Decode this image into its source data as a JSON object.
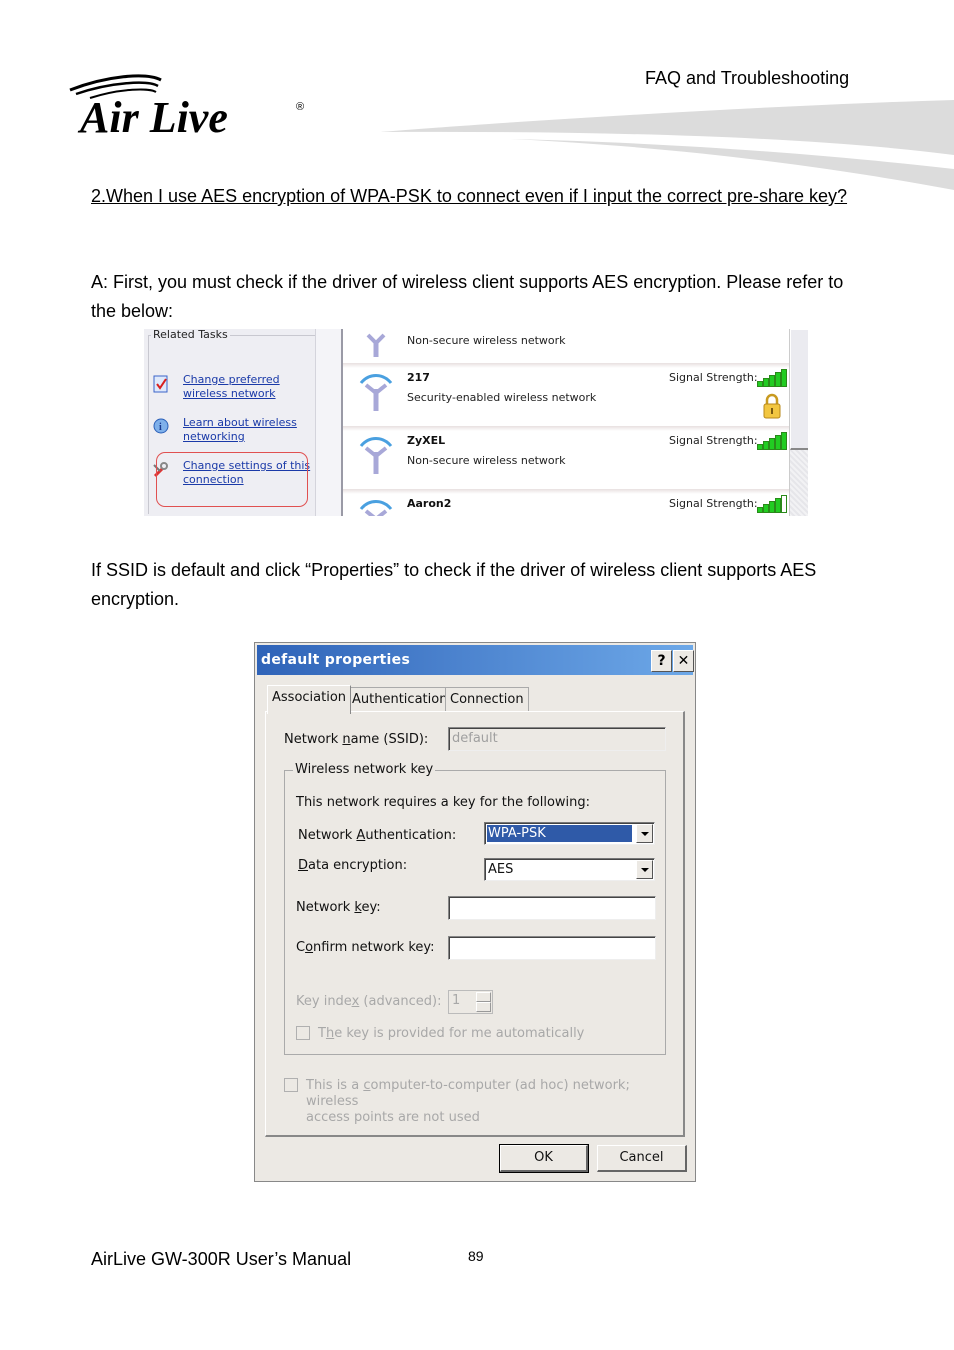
{
  "header": {
    "logo_text": "Air Live",
    "logo_mark": "®",
    "section_title": "FAQ and Troubleshooting"
  },
  "question": "2.When I use AES encryption of WPA-PSK to connect even if I input the correct pre-share key?",
  "answer": "A: First, you must check if the driver of wireless client supports AES encryption. Please refer to the below:",
  "instruction": "If SSID is default and click “Properties” to check if the driver of wireless client supports AES encryption.",
  "screenshot1": {
    "related_tasks": {
      "title": "Related Tasks",
      "items": [
        {
          "label": "Change preferred wireless network",
          "icon": "checklist-icon"
        },
        {
          "label": "Learn about wireless networking",
          "icon": "info-icon"
        },
        {
          "label": "Change settings of this connection",
          "icon": "settings-tools-icon",
          "highlighted": true
        }
      ]
    },
    "signal_label": "Signal Strength:",
    "networks": [
      {
        "name": "",
        "description": "Non-secure wireless network",
        "signal_bars": null,
        "secured": false
      },
      {
        "name": "217",
        "description": "Security-enabled wireless network",
        "signal_bars": 5,
        "secured": true
      },
      {
        "name": "ZyXEL",
        "description": "Non-secure wireless network",
        "signal_bars": 5,
        "secured": false
      },
      {
        "name": "Aaron2",
        "description": "",
        "signal_bars": 4,
        "secured": false
      }
    ],
    "signal_max": 5
  },
  "dialog": {
    "title": "default properties",
    "help_button": "?",
    "close_button": "✕",
    "tabs": [
      {
        "label": "Association",
        "active": true
      },
      {
        "label": "Authentication",
        "active": false
      },
      {
        "label": "Connection",
        "active": false
      }
    ],
    "ssid_label_pre": "Network ",
    "ssid_label_acc": "n",
    "ssid_label_post": "ame (SSID):",
    "ssid_value": "default",
    "group_title": "Wireless network key",
    "requires_text": "This network requires a key for the following:",
    "auth_label_pre": "Network ",
    "auth_label_acc": "A",
    "auth_label_post": "uthentication:",
    "auth_value": "WPA-PSK",
    "enc_label_acc": "D",
    "enc_label_post": "ata encryption:",
    "enc_value": "AES",
    "key_label_pre": "Network ",
    "key_label_acc": "k",
    "key_label_post": "ey:",
    "key_value": "",
    "confirm_label_pre": "C",
    "confirm_label_acc": "o",
    "confirm_label_post": "nfirm network key:",
    "confirm_value": "",
    "index_label_pre": "Key inde",
    "index_label_acc": "x",
    "index_label_post": " (advanced):",
    "index_value": "1",
    "auto_key_pre": "T",
    "auto_key_acc": "h",
    "auto_key_post": "e key is provided for me automatically",
    "adhoc_pre": "This is a ",
    "adhoc_acc": "c",
    "adhoc_post": "omputer-to-computer (ad hoc) network; wireless",
    "adhoc_line2": "access points are not used",
    "ok_label": "OK",
    "cancel_label": "Cancel"
  },
  "footer": {
    "manual": "AirLive GW-300R User’s Manual",
    "page_number": "89"
  },
  "colors": {
    "title_bar_start": "#2f63b8",
    "title_bar_end": "#6da8e8",
    "link": "#1a3aa8",
    "highlight_box": "#e05050",
    "signal_green": "#22cc22",
    "selection": "#2f5aa8"
  }
}
